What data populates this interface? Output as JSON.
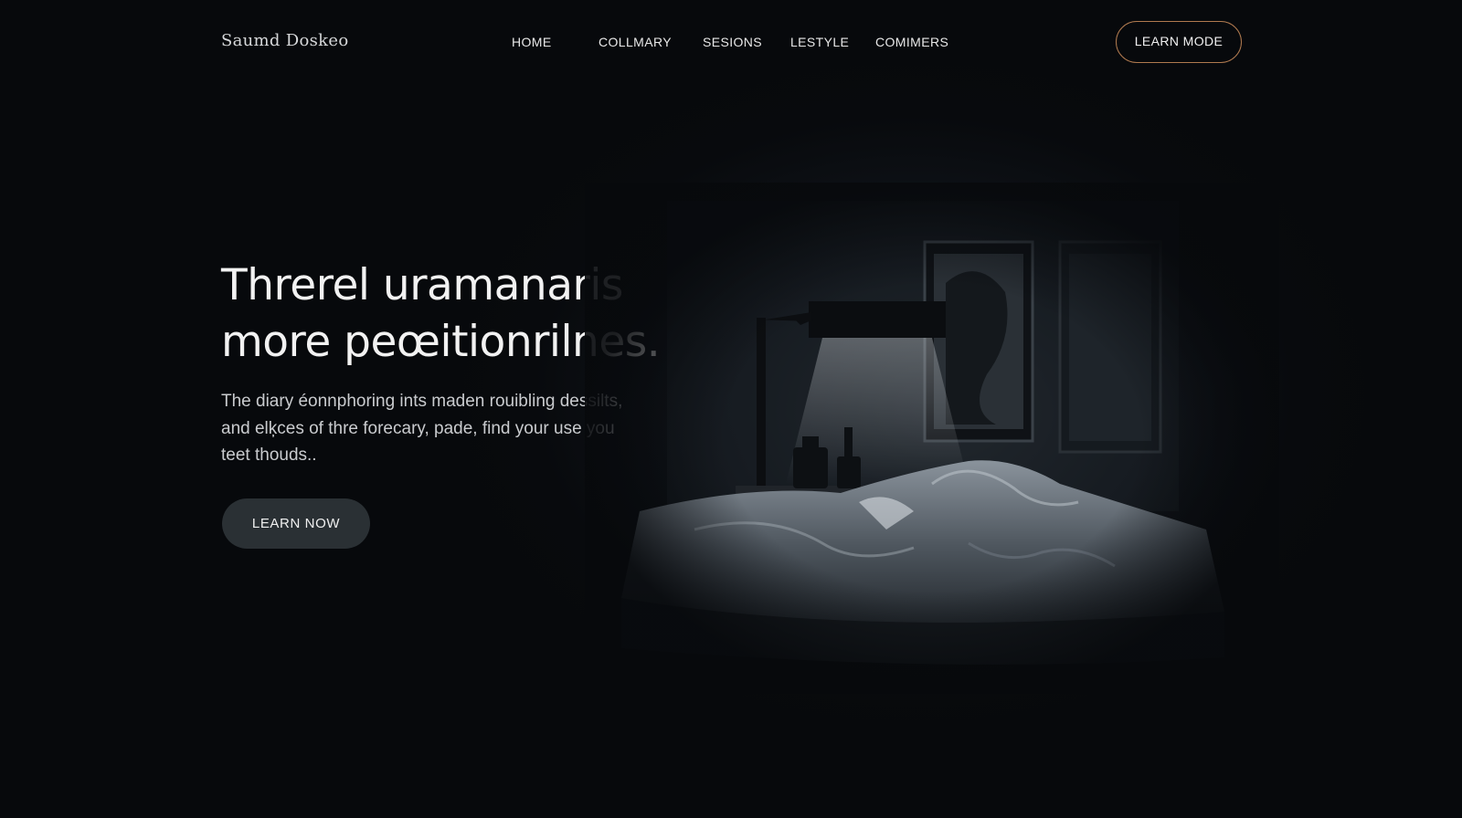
{
  "header": {
    "logo": "Saumd Doskeo",
    "nav": [
      "HOME",
      "COLLMARY",
      "SESIONS",
      "LESTYLE",
      "COMIMERS"
    ],
    "cta_label": "LEARN MODE"
  },
  "hero": {
    "title_lines": [
      "Threrel uramanaris",
      "more peœitionrilnes."
    ],
    "description_lines": [
      "The diary éonnphoring ints maden rouibling dessilts,",
      "and elķces of thre forecary, pade, find your use you",
      "teet thouds.."
    ],
    "cta_label": "LEARN NOW"
  },
  "scene": {
    "icons": [
      "desk-lamp-icon",
      "framed-picture-icon",
      "bed-icon",
      "bottle-icon"
    ]
  },
  "colors": {
    "background": "#07090c",
    "accent_border": "#b07a4f",
    "button_fill": "#2a3034",
    "text": "#f2f2f2"
  }
}
